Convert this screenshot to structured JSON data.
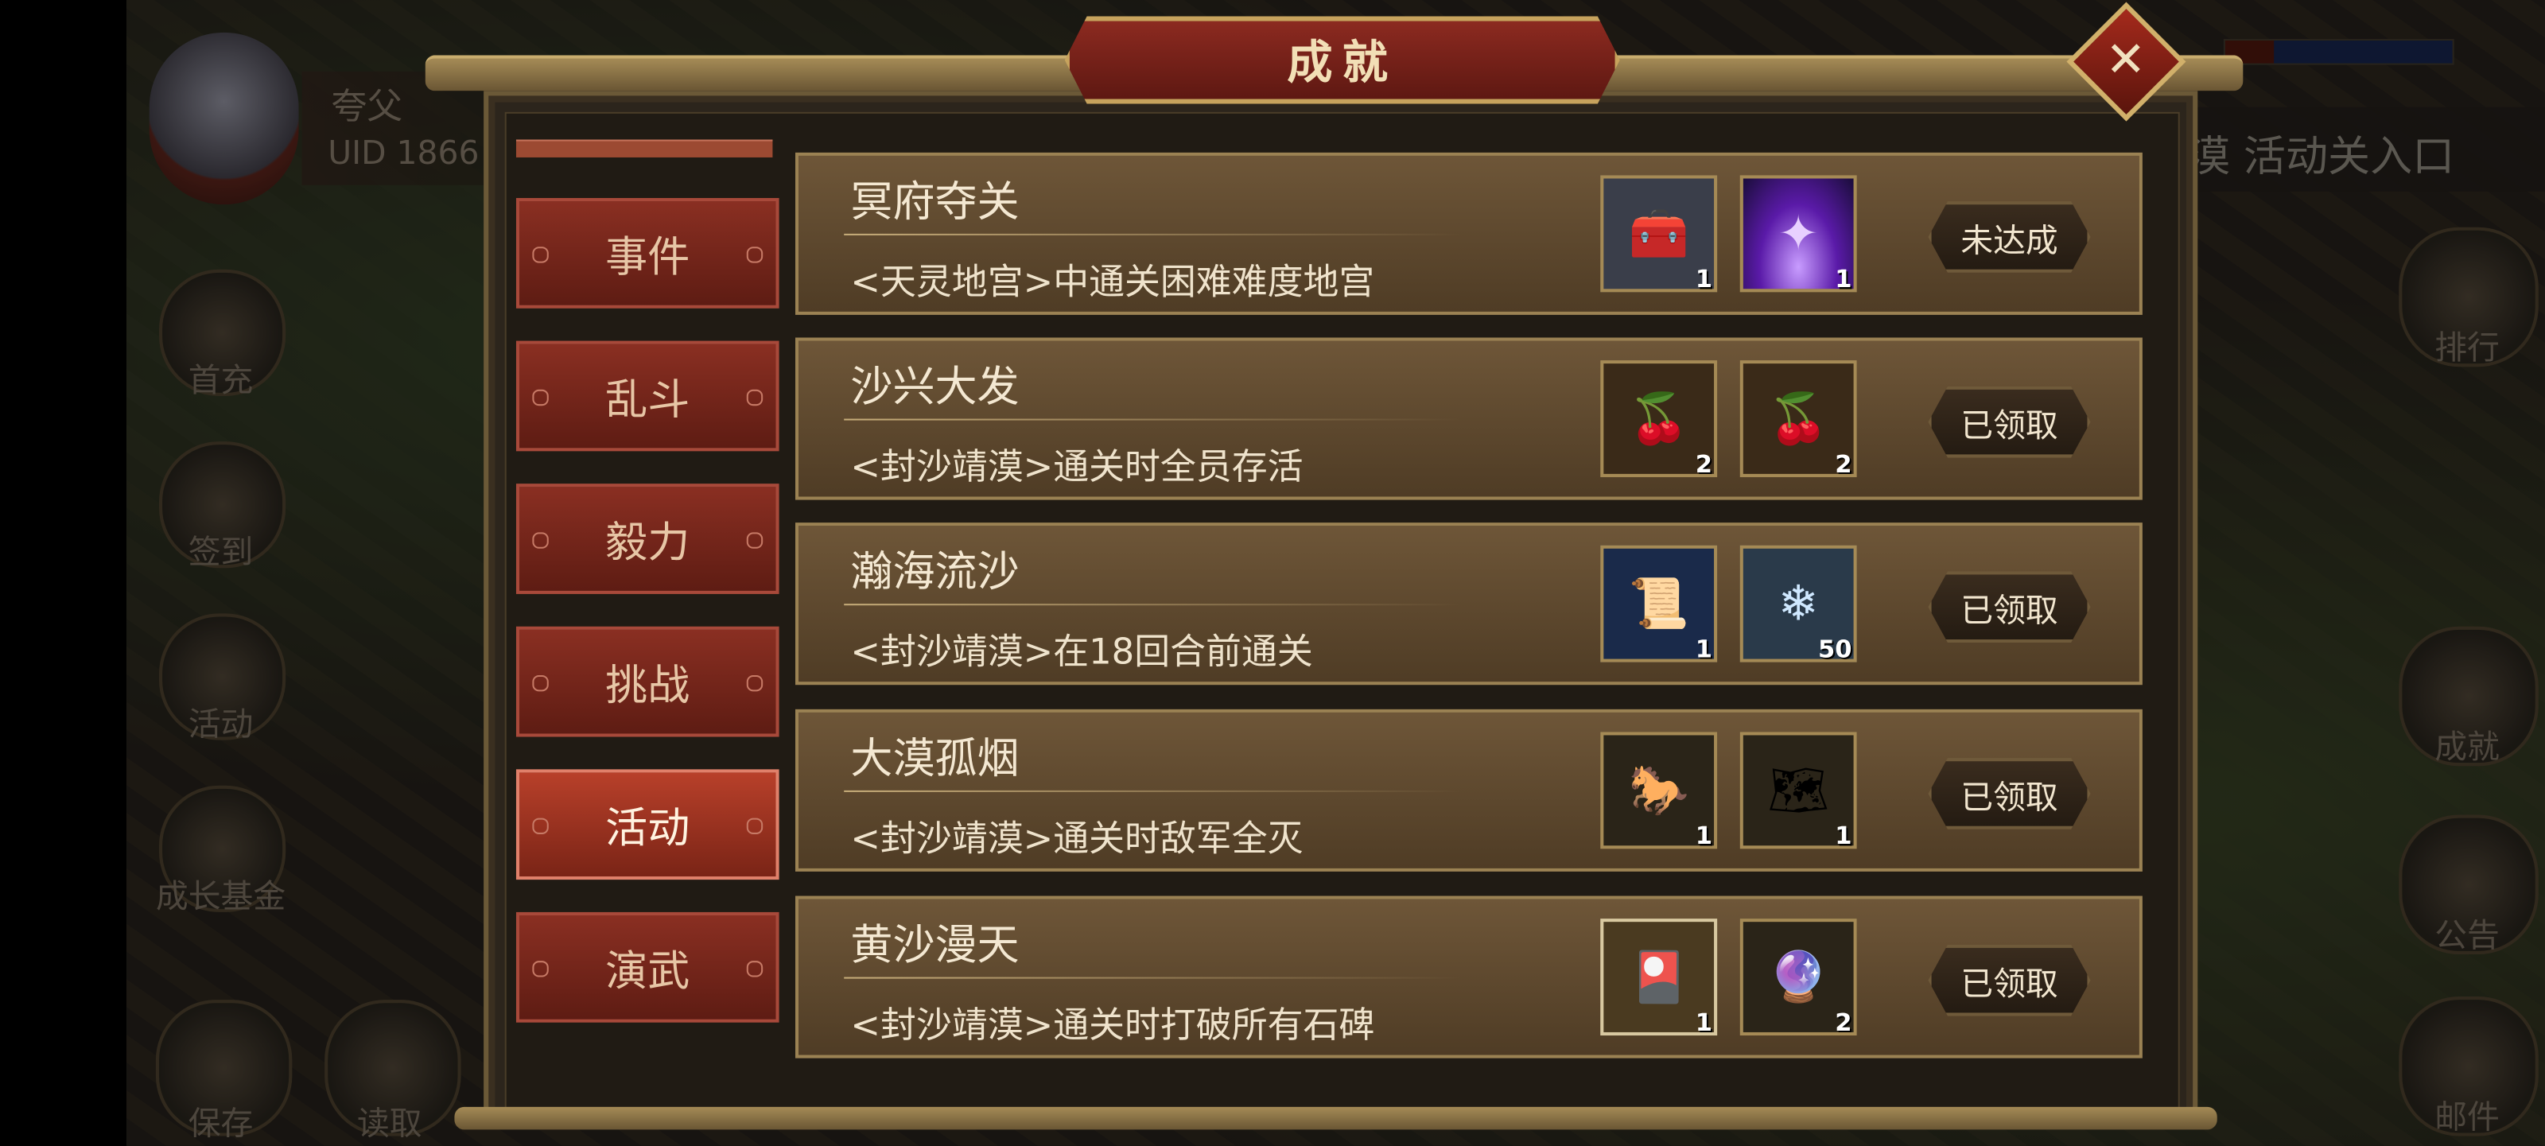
{
  "dialog": {
    "title": "成就",
    "close_icon": "close-icon"
  },
  "hud": {
    "player_name": "夸父",
    "uid": "UID  1866",
    "left_buttons": [
      {
        "label": "首充",
        "icon": "gift-icon"
      },
      {
        "label": "签到",
        "icon": "scroll-icon"
      },
      {
        "label": "活动",
        "icon": "lantern-icon"
      },
      {
        "label": "成长基金",
        "icon": "plant-icon"
      }
    ],
    "bottom_buttons": [
      {
        "label": "保存",
        "icon": "save-icon"
      },
      {
        "label": "读取",
        "icon": "load-icon"
      }
    ],
    "right_buttons": [
      {
        "label": "排行",
        "icon": "ranking-icon"
      },
      {
        "label": "成就",
        "icon": "achievement-icon"
      },
      {
        "label": "公告",
        "icon": "notice-icon"
      },
      {
        "label": "邮件",
        "icon": "mail-icon"
      }
    ],
    "right_banner": "漠 活动关入口"
  },
  "tabs": [
    {
      "label": "事件",
      "active": false
    },
    {
      "label": "乱斗",
      "active": false
    },
    {
      "label": "毅力",
      "active": false
    },
    {
      "label": "挑战",
      "active": false
    },
    {
      "label": "活动",
      "active": true
    },
    {
      "label": "演武",
      "active": false
    }
  ],
  "achievements": [
    {
      "title": "冥府夺关",
      "desc": "<天灵地宫>中通关困难难度地宫",
      "status": "未达成",
      "rewards": [
        {
          "icon": "silver-chest-icon",
          "glyph": "🧰",
          "qty": "1"
        },
        {
          "icon": "purple-light-icon",
          "glyph": "✦",
          "qty": "1"
        }
      ]
    },
    {
      "title": "沙兴大发",
      "desc": "<封沙靖漠>通关时全员存活",
      "status": "已领取",
      "rewards": [
        {
          "icon": "orange-cherry-icon",
          "glyph": "🍒",
          "qty": "2"
        },
        {
          "icon": "red-cherry-icon",
          "glyph": "🍒",
          "qty": "2"
        }
      ]
    },
    {
      "title": "瀚海流沙",
      "desc": "<封沙靖漠>在18回合前通关",
      "status": "已领取",
      "rewards": [
        {
          "icon": "blue-scroll-icon",
          "glyph": "📜",
          "qty": "1"
        },
        {
          "icon": "ice-crystal-icon",
          "glyph": "❄",
          "qty": "50"
        }
      ]
    },
    {
      "title": "大漠孤烟",
      "desc": "<封沙靖漠>通关时敌军全灭",
      "status": "已领取",
      "rewards": [
        {
          "icon": "war-horse-icon",
          "glyph": "🐎",
          "qty": "1"
        },
        {
          "icon": "map-scroll-icon",
          "glyph": "🗺",
          "qty": "1"
        }
      ]
    },
    {
      "title": "黄沙漫天",
      "desc": "<封沙靖漠>通关时打破所有石碑",
      "status": "已领取",
      "rewards": [
        {
          "icon": "gold-card-icon",
          "glyph": "🎴",
          "qty": "1"
        },
        {
          "icon": "rainbow-orb-icon",
          "glyph": "🔮",
          "qty": "2"
        }
      ]
    }
  ]
}
